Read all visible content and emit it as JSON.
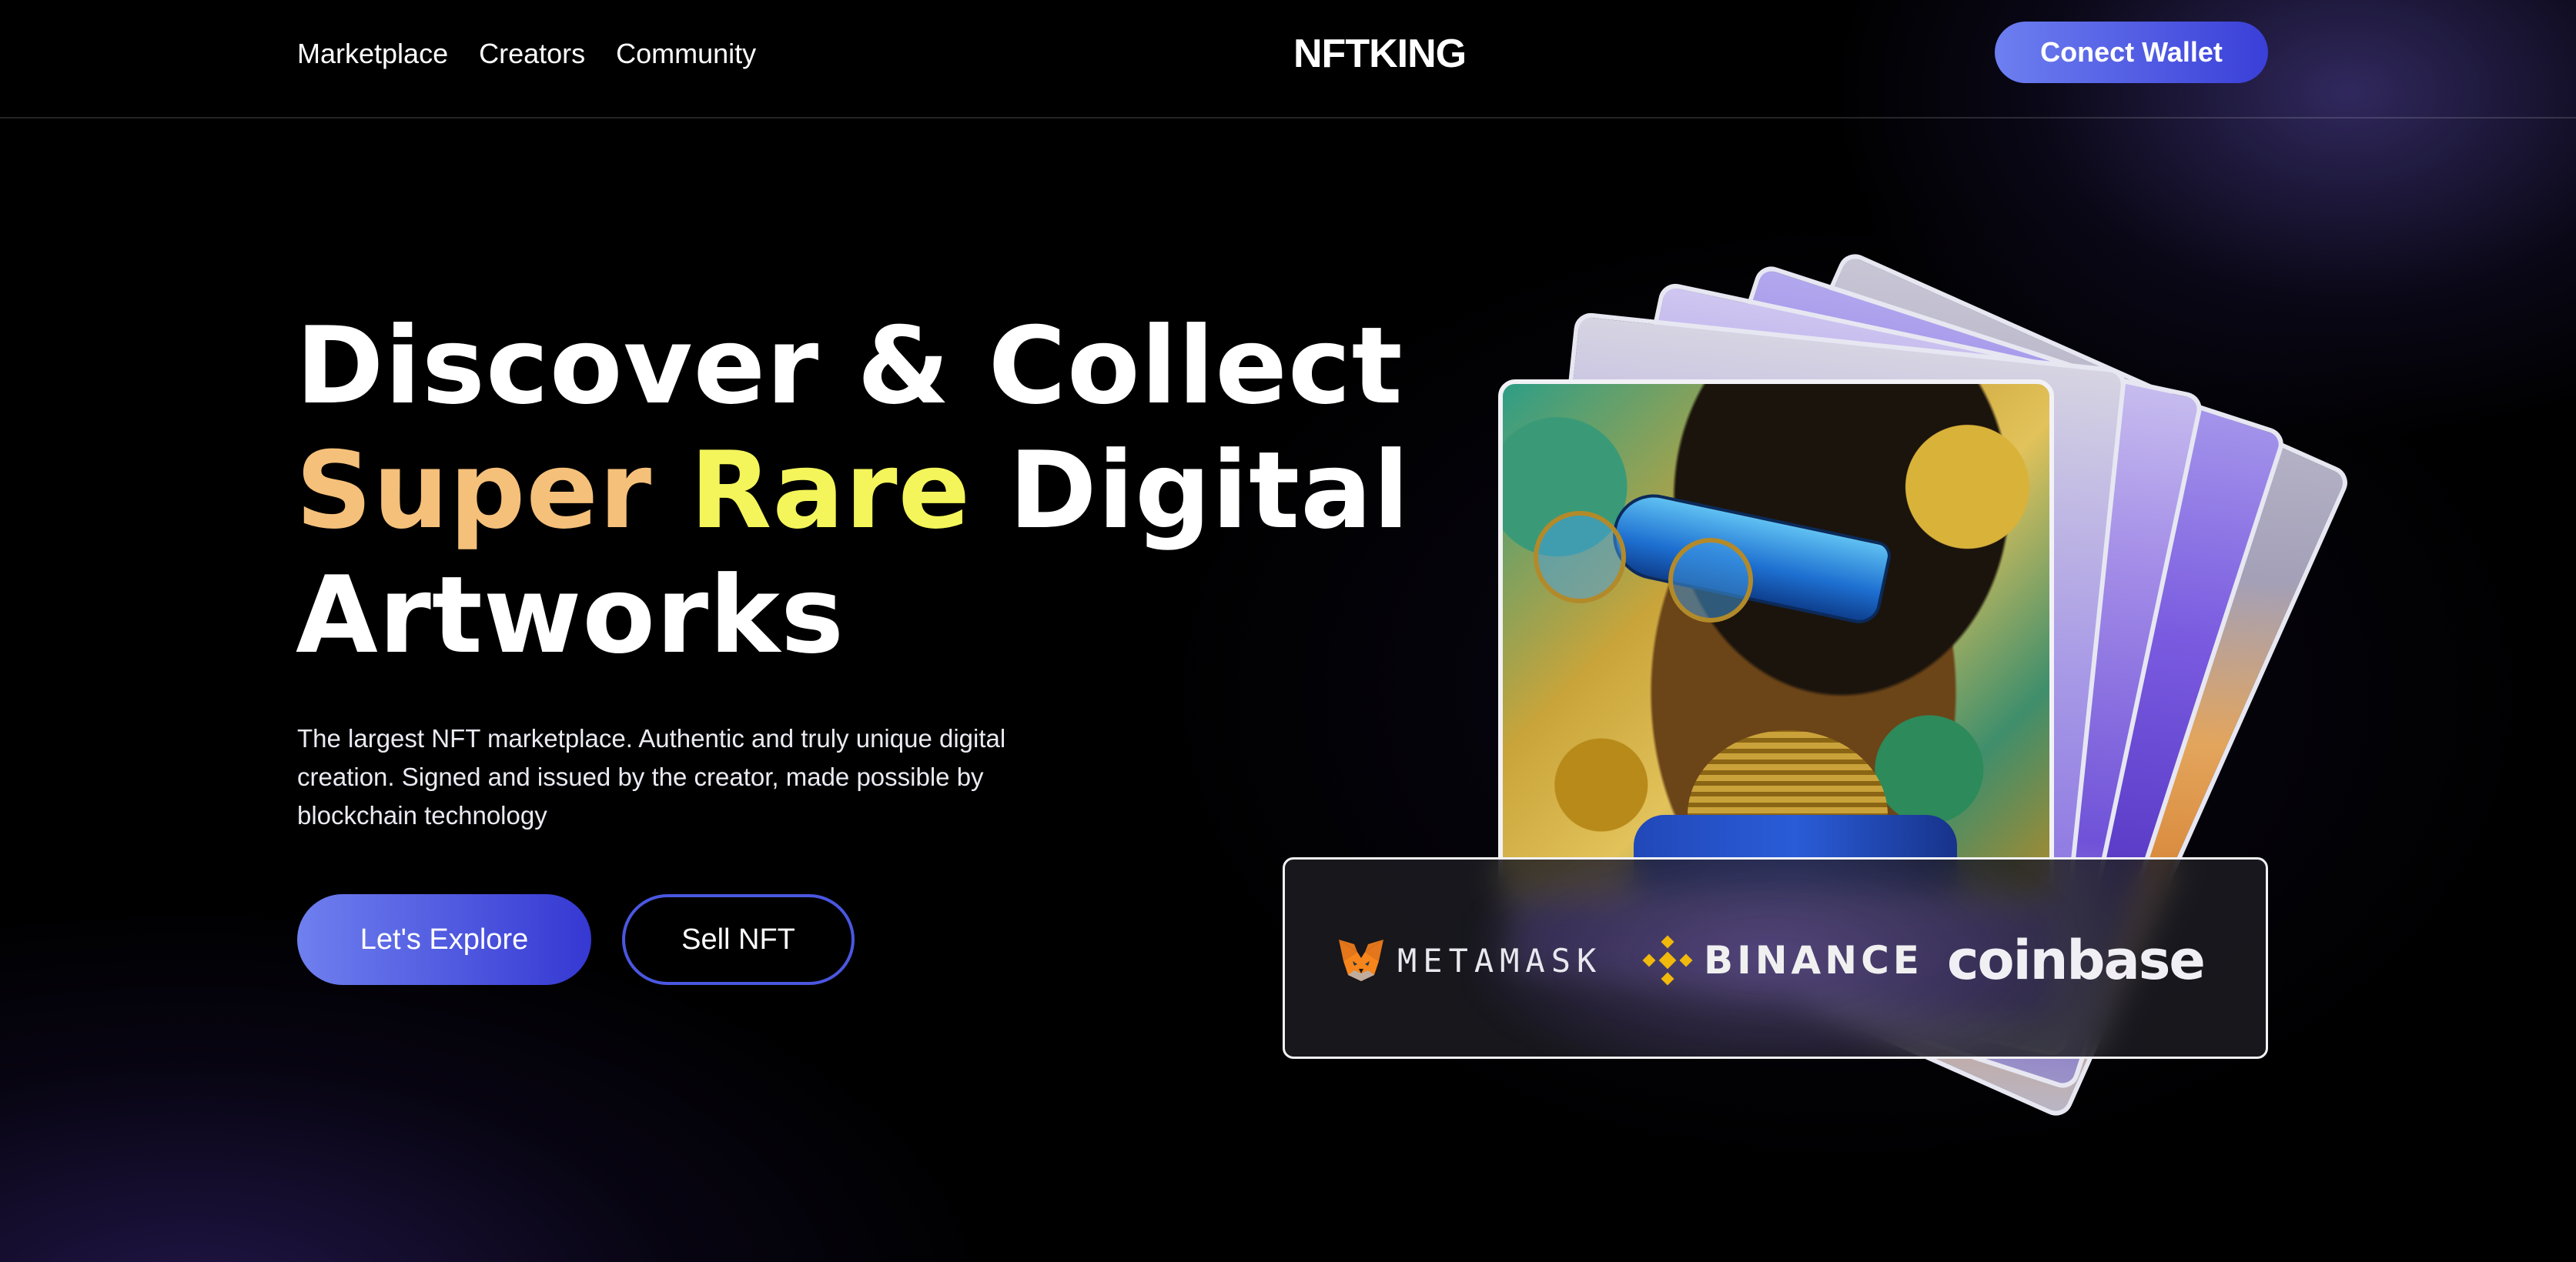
{
  "header": {
    "nav": [
      {
        "label": "Marketplace"
      },
      {
        "label": "Creators"
      },
      {
        "label": "Community"
      }
    ],
    "brand": "NFTKING",
    "connect_label": "Conect Wallet"
  },
  "hero": {
    "title_line1": "Discover & Collect",
    "title_super": "Super",
    "title_rare": "Rare",
    "title_digital": "Digital",
    "title_line3": "Artworks",
    "description": "The largest NFT marketplace. Authentic and truly unique digital creation. Signed and issued by the creator, made possible by blockchain technology",
    "explore_label": "Let's Explore",
    "sell_label": "Sell NFT"
  },
  "wallets": [
    {
      "name": "METAMASK",
      "icon": "metamask-fox-icon"
    },
    {
      "name": "BINANCE",
      "icon": "binance-icon"
    },
    {
      "name": "coinbase",
      "icon": ""
    }
  ],
  "colors": {
    "accent_start": "#6f80ef",
    "accent_end": "#3538d2",
    "highlight_super": "#f5c07a",
    "highlight_rare": "#f3f55a"
  }
}
